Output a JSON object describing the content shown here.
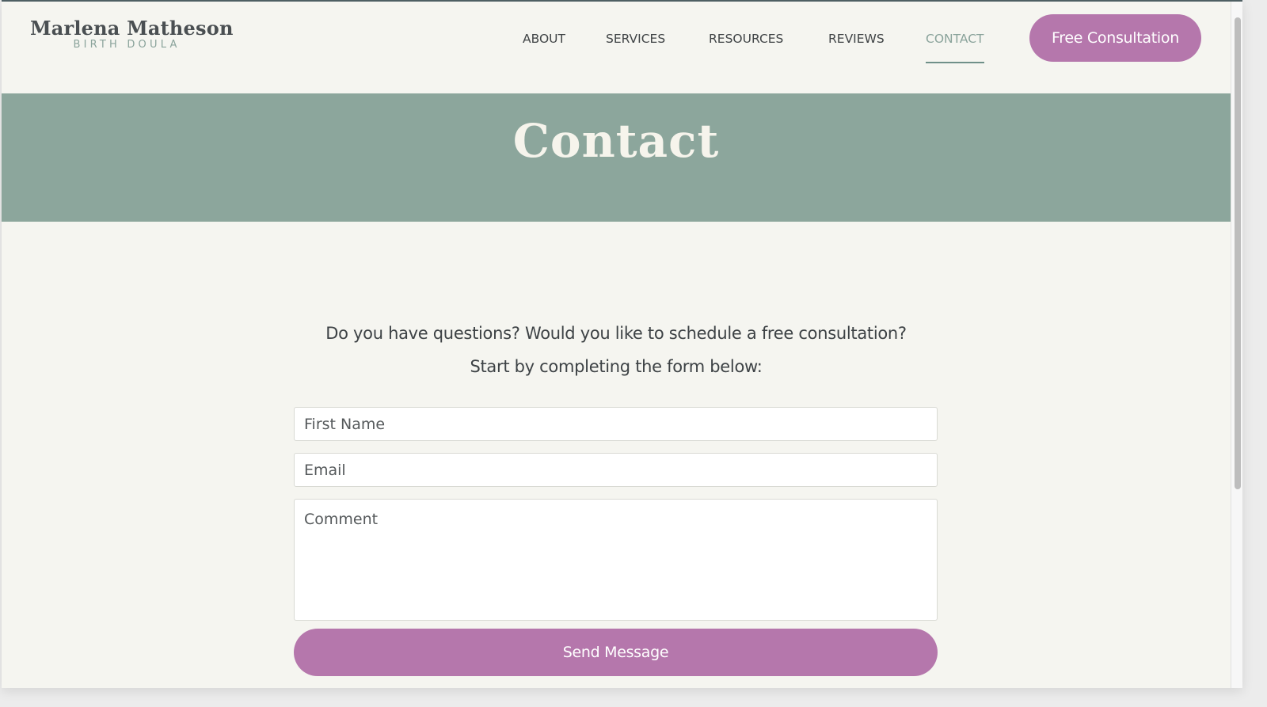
{
  "site": {
    "logo_name": "Marlena Matheson",
    "logo_subtitle": "BIRTH DOULA"
  },
  "nav": {
    "items": [
      {
        "label": "ABOUT",
        "active": false
      },
      {
        "label": "SERVICES",
        "active": false
      },
      {
        "label": "RESOURCES",
        "active": false
      },
      {
        "label": "REVIEWS",
        "active": false
      },
      {
        "label": "CONTACT",
        "active": true
      }
    ],
    "cta_label": "Free Consultation"
  },
  "banner": {
    "title": "Contact"
  },
  "intro": {
    "line1": "Do you have questions? Would you like to schedule a free consultation?",
    "line2": "Start by completing the form below:"
  },
  "form": {
    "first_name_placeholder": "First Name",
    "email_placeholder": "Email",
    "comment_placeholder": "Comment",
    "first_name_value": "",
    "email_value": "",
    "comment_value": "",
    "submit_label": "Send Message"
  },
  "colors": {
    "accent": "#b577ac",
    "banner": "#8ca69c",
    "background": "#f5f5f0",
    "active_nav": "#8aa39b"
  }
}
